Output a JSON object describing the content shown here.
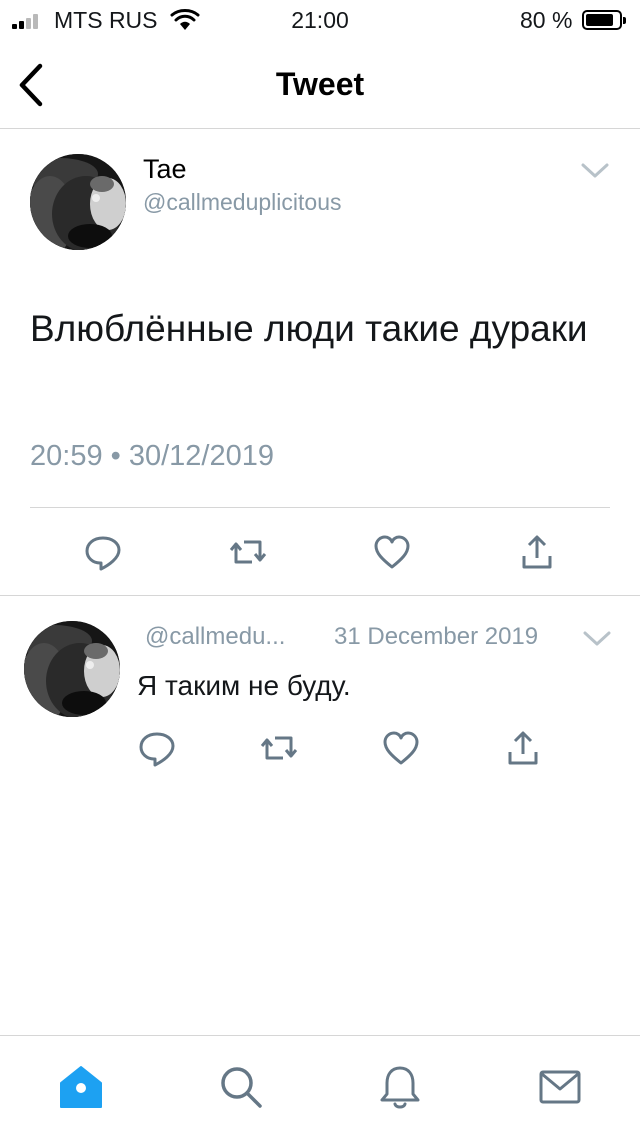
{
  "status_bar": {
    "carrier": "MTS RUS",
    "time": "21:00",
    "battery_percent": "80 %",
    "signal_bars": 2,
    "battery_level": 0.8
  },
  "nav": {
    "title": "Tweet",
    "back_icon": "chevron-left-icon"
  },
  "main_tweet": {
    "author_name": "Tae",
    "author_handle": "@callmeduplicitous",
    "text": "Влюблённые люди такие дураки",
    "timestamp": "20:59 • 30/12/2019",
    "menu_icon": "chevron-down-icon",
    "actions": [
      "reply-icon",
      "retweet-icon",
      "like-icon",
      "share-icon"
    ]
  },
  "reply": {
    "author_handle": "@callmedu...",
    "date": "31 December 2019",
    "text": "Я таким не буду.",
    "menu_icon": "chevron-down-icon",
    "actions": [
      "reply-icon",
      "retweet-icon",
      "like-icon",
      "share-icon"
    ]
  },
  "tab_bar": {
    "tabs": [
      "home-icon",
      "search-icon",
      "notifications-icon",
      "messages-icon"
    ],
    "active_tab": "home-icon"
  },
  "colors": {
    "accent": "#1da1f2",
    "icon_gray": "#657786",
    "secondary_text": "#8899a6",
    "divider": "#d6d6d6"
  }
}
